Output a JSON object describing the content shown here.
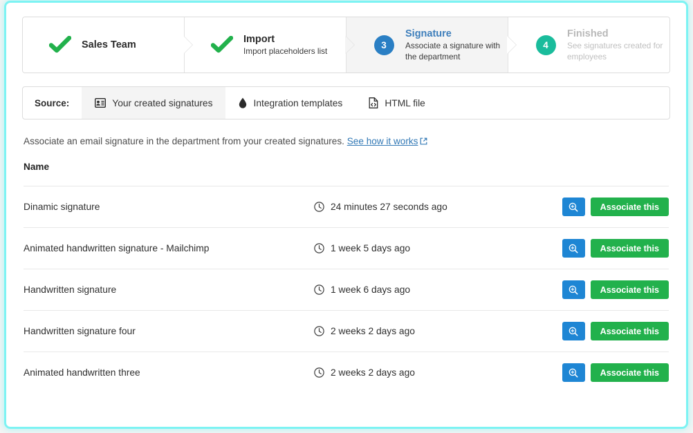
{
  "colors": {
    "frame_glow": "#7df3f3",
    "check_green": "#22b14c",
    "step_active_badge": "#2a7fc4",
    "step_done_badge": "#1abc9c",
    "link_blue": "#3178b5",
    "preview_blue": "#1e86d4",
    "associate_green": "#22b14c"
  },
  "stepper": {
    "steps": [
      {
        "mark": "check-icon",
        "number": "",
        "title": "Sales Team",
        "subtitle": "",
        "state": "done"
      },
      {
        "mark": "check-icon",
        "number": "",
        "title": "Import",
        "subtitle": "Import placeholders list",
        "state": "done"
      },
      {
        "mark": "number-badge",
        "number": "3",
        "title": "Signature",
        "subtitle": "Associate a signature with the department",
        "state": "active"
      },
      {
        "mark": "number-badge",
        "number": "4",
        "title": "Finished",
        "subtitle": "See signatures created for employees",
        "state": "upcoming"
      }
    ]
  },
  "source_bar": {
    "label": "Source:",
    "tabs": [
      {
        "label": "Your created signatures",
        "icon": "id-card-icon",
        "selected": true
      },
      {
        "label": "Integration templates",
        "icon": "droplet-icon",
        "selected": false
      },
      {
        "label": "HTML file",
        "icon": "file-code-icon",
        "selected": false
      }
    ]
  },
  "description": {
    "text": "Associate an email signature in the department from your created signatures.",
    "link_text": "See how it works",
    "link_icon": "external-link-icon"
  },
  "table": {
    "header_name": "Name",
    "rows": [
      {
        "name": "Dinamic signature",
        "time": "24 minutes 27 seconds ago",
        "preview_icon": "zoom-in-icon",
        "associate_label": "Associate this"
      },
      {
        "name": "Animated handwritten signature - Mailchimp",
        "time": "1 week 5 days ago",
        "preview_icon": "zoom-in-icon",
        "associate_label": "Associate this"
      },
      {
        "name": "Handwritten signature",
        "time": "1 week 6 days ago",
        "preview_icon": "zoom-in-icon",
        "associate_label": "Associate this"
      },
      {
        "name": "Handwritten signature four",
        "time": "2 weeks 2 days ago",
        "preview_icon": "zoom-in-icon",
        "associate_label": "Associate this"
      },
      {
        "name": "Animated handwritten three",
        "time": "2 weeks 2 days ago",
        "preview_icon": "zoom-in-icon",
        "associate_label": "Associate this"
      }
    ]
  }
}
